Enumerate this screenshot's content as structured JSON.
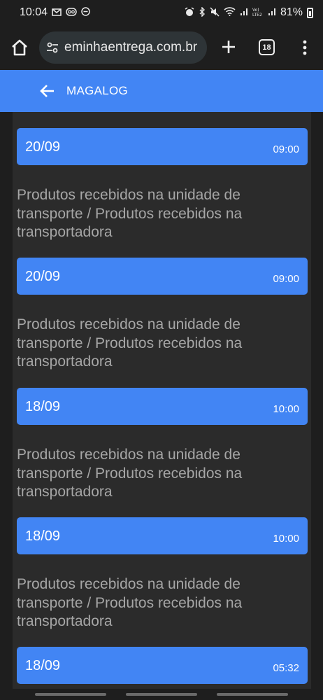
{
  "status_bar": {
    "time": "10:04",
    "battery": "81%",
    "icons_left": [
      "gmail-icon",
      "voicemail-icon",
      "dnd-icon"
    ],
    "icons_right": [
      "alarm-icon",
      "bluetooth-icon",
      "mute-icon",
      "wifi-icon",
      "signal-icon",
      "volte-icon",
      "signal-icon",
      "battery-icon"
    ]
  },
  "browser": {
    "url": "eminhaentrega.com.br",
    "tab_count": "18"
  },
  "header": {
    "title": "MAGALOG"
  },
  "events": [
    {
      "date": "20/09",
      "time": "09:00",
      "description": "Produtos recebidos na unidade de transporte / Produtos recebidos na transportadora"
    },
    {
      "date": "20/09",
      "time": "09:00",
      "description": "Produtos recebidos na unidade de transporte / Produtos recebidos na transportadora"
    },
    {
      "date": "18/09",
      "time": "10:00",
      "description": "Produtos recebidos na unidade de transporte / Produtos recebidos na transportadora"
    },
    {
      "date": "18/09",
      "time": "10:00",
      "description": "Produtos recebidos na unidade de transporte / Produtos recebidos na transportadora"
    },
    {
      "date": "18/09",
      "time": "05:32",
      "description": ""
    }
  ],
  "colors": {
    "accent": "#4285f4",
    "background": "#1e1e1e",
    "panel": "#2b2b2b",
    "event_text": "#a6a6a6"
  }
}
